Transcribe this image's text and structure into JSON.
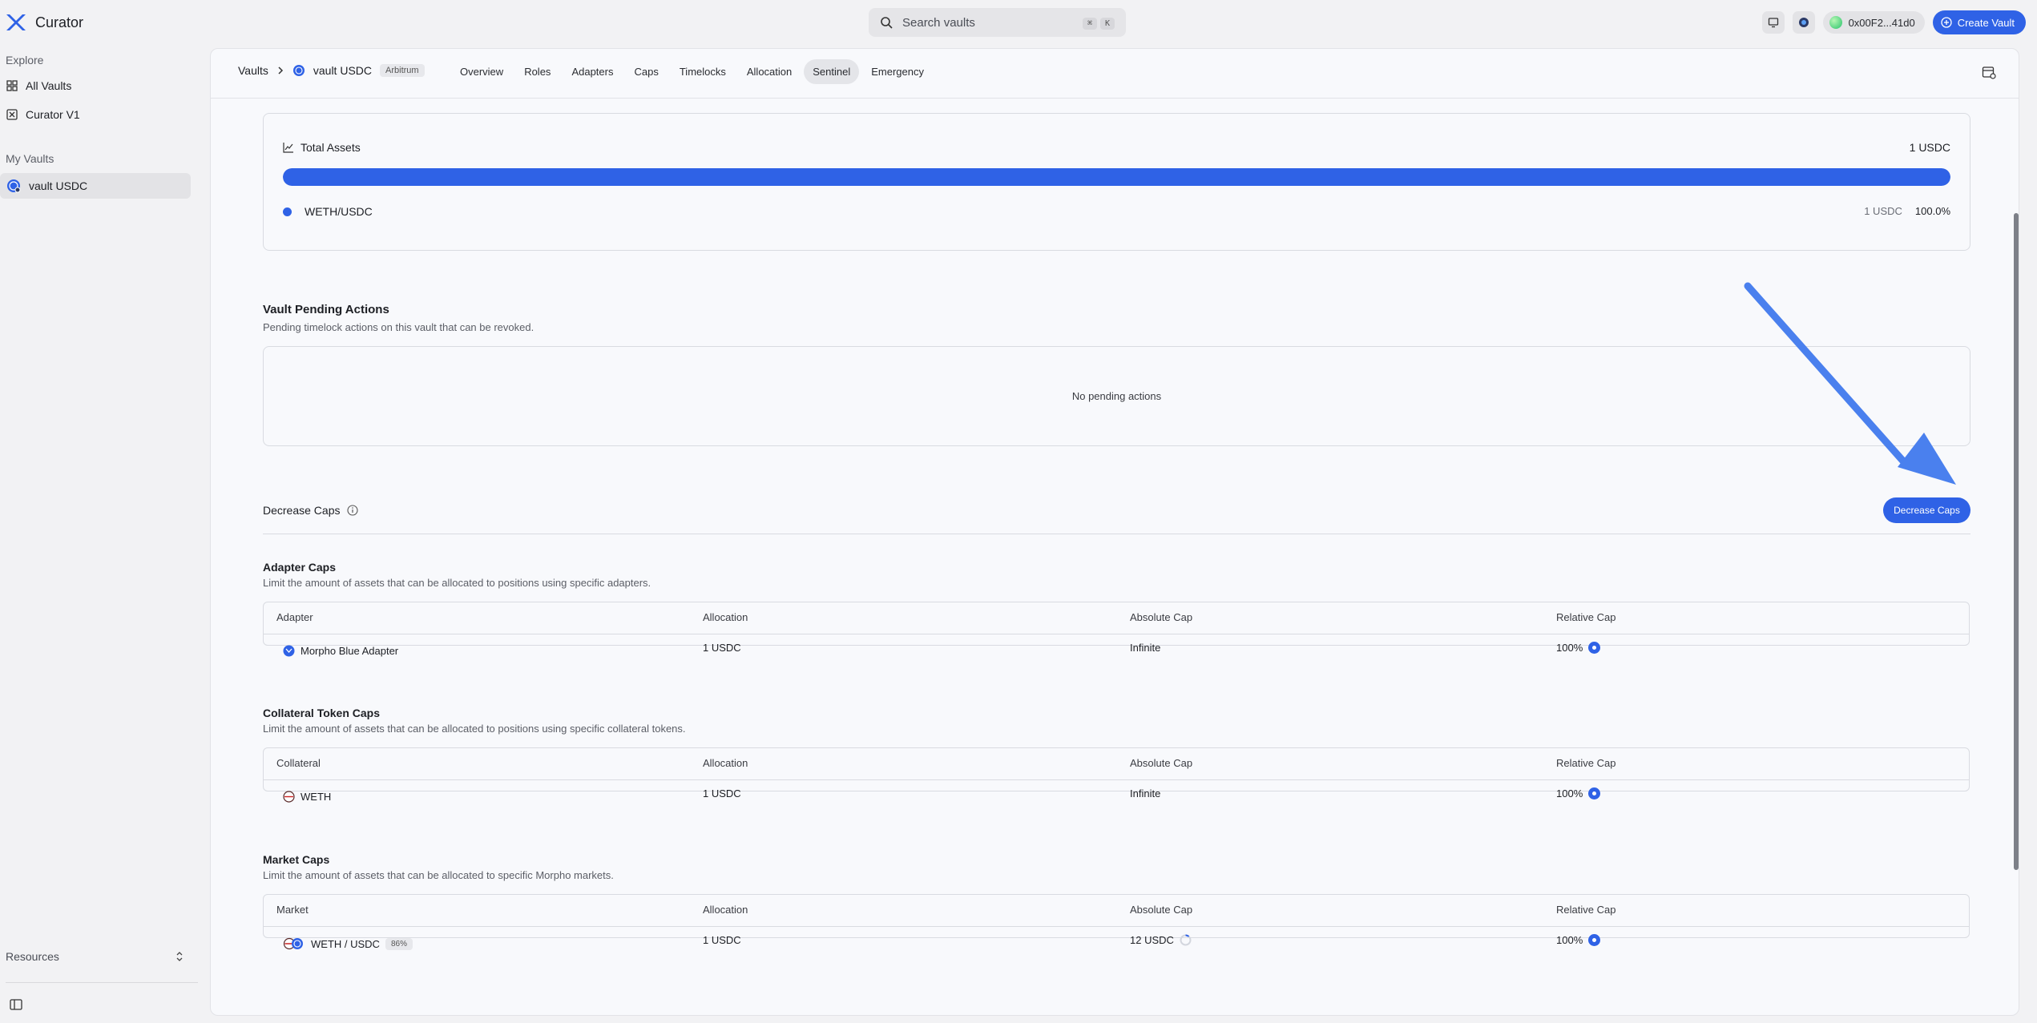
{
  "brand": {
    "name": "Curator"
  },
  "search": {
    "placeholder": "Search vaults",
    "kbd1": "⌘",
    "kbd2": "K"
  },
  "topbar": {
    "wallet": "0x00F2...41d0",
    "create_label": "Create Vault"
  },
  "sidebar": {
    "explore_label": "Explore",
    "explore_items": [
      {
        "label": "All Vaults"
      },
      {
        "label": "Curator V1"
      }
    ],
    "my_vaults_label": "My Vaults",
    "my_vaults": [
      {
        "label": "vault USDC"
      }
    ],
    "resources_label": "Resources"
  },
  "breadcrumb": {
    "root": "Vaults",
    "vault": "vault USDC",
    "chain": "Arbitrum"
  },
  "tabs": [
    {
      "label": "Overview"
    },
    {
      "label": "Roles"
    },
    {
      "label": "Adapters"
    },
    {
      "label": "Caps"
    },
    {
      "label": "Timelocks"
    },
    {
      "label": "Allocation"
    },
    {
      "label": "Sentinel"
    },
    {
      "label": "Emergency"
    }
  ],
  "active_tab": "Sentinel",
  "total_assets": {
    "title": "Total Assets",
    "value": "1 USDC",
    "bar_fraction": 1.0,
    "legend_label": "WETH/USDC",
    "legend_amount": "1 USDC",
    "legend_percent": "100.0%"
  },
  "pending": {
    "title": "Vault Pending Actions",
    "description": "Pending timelock actions on this vault that can be revoked.",
    "empty_text": "No pending actions"
  },
  "decrease_caps": {
    "title": "Decrease Caps",
    "button_label": "Decrease Caps"
  },
  "adapter_caps": {
    "title": "Adapter Caps",
    "description": "Limit the amount of assets that can be allocated to positions using specific adapters.",
    "headers": [
      "Adapter",
      "Allocation",
      "Absolute Cap",
      "Relative Cap"
    ],
    "row": {
      "name": "Morpho Blue Adapter",
      "allocation": "1 USDC",
      "absolute_cap": "Infinite",
      "relative_cap": "100%"
    }
  },
  "collateral_caps": {
    "title": "Collateral Token Caps",
    "description": "Limit the amount of assets that can be allocated to positions using specific collateral tokens.",
    "headers": [
      "Collateral",
      "Allocation",
      "Absolute Cap",
      "Relative Cap"
    ],
    "row": {
      "name": "WETH",
      "allocation": "1 USDC",
      "absolute_cap": "Infinite",
      "relative_cap": "100%"
    }
  },
  "market_caps": {
    "title": "Market Caps",
    "description": "Limit the amount of assets that can be allocated to specific Morpho markets.",
    "headers": [
      "Market",
      "Allocation",
      "Absolute Cap",
      "Relative Cap"
    ],
    "row": {
      "name": "WETH / USDC",
      "lltv": "86%",
      "allocation": "1 USDC",
      "absolute_cap": "12 USDC",
      "relative_cap": "100%"
    }
  },
  "colors": {
    "accent": "#2f62e6",
    "arrow": "#4a80ee"
  }
}
